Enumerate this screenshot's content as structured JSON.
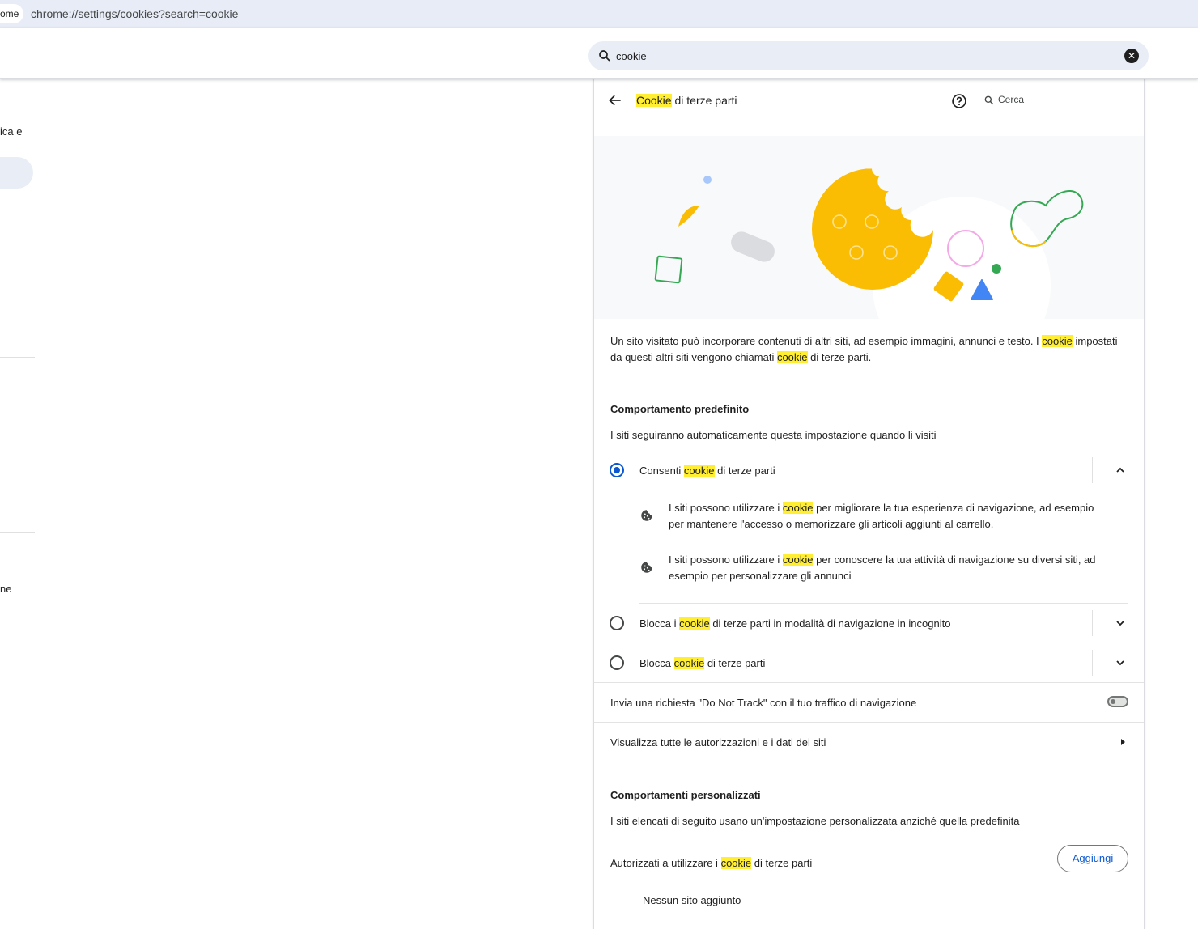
{
  "browser": {
    "tab_fragment": "ome",
    "url": "chrome://settings/cookies?search=cookie"
  },
  "settings_search": {
    "value": "cookie",
    "clear_glyph": "✕"
  },
  "left_nav": {
    "fragment_1": "ica e",
    "fragment_2": "ne"
  },
  "panel": {
    "title_highlight": "Cookie",
    "title_rest": " di terze parti",
    "search_placeholder": "Cerca",
    "description": {
      "part1": "Un sito visitato può incorporare contenuti di altri siti, ad esempio immagini, annunci e testo. I ",
      "hl1": "cookie",
      "part2": " impostati da questi altri siti vengono chiamati ",
      "hl2": "cookie",
      "part3": " di terze parti."
    },
    "default_behavior": {
      "title": "Comportamento predefinito",
      "subtitle": "I siti seguiranno automaticamente questa impostazione quando li visiti",
      "options": [
        {
          "pre": "Consenti ",
          "hl": "cookie",
          "post": " di terze parti",
          "selected": true,
          "expanded": true
        },
        {
          "pre": "Blocca i ",
          "hl": "cookie",
          "post": " di terze parti in modalità di navigazione in incognito",
          "selected": false,
          "expanded": false
        },
        {
          "pre": "Blocca ",
          "hl": "cookie",
          "post": " di terze parti",
          "selected": false,
          "expanded": false
        }
      ],
      "details": [
        {
          "pre": "I siti possono utilizzare i ",
          "hl": "cookie",
          "post": " per migliorare la tua esperienza di navigazione, ad esempio per mantenere l'accesso o memorizzare gli articoli aggiunti al carrello."
        },
        {
          "pre": "I siti possono utilizzare i ",
          "hl": "cookie",
          "post": " per conoscere la tua attività di navigazione su diversi siti, ad esempio per personalizzare gli annunci"
        }
      ]
    },
    "do_not_track": {
      "label": "Invia una richiesta \"Do Not Track\" con il tuo traffico di navigazione",
      "enabled": false
    },
    "site_data_link": "Visualizza tutte le autorizzazioni e i dati dei siti",
    "custom_behavior": {
      "title": "Comportamenti personalizzati",
      "subtitle": "I siti elencati di seguito usano un'impostazione personalizzata anziché quella predefinita",
      "allowed": {
        "pre": "Autorizzati a utilizzare i ",
        "hl": "cookie",
        "post": " di terze parti"
      },
      "add_button": "Aggiungi",
      "empty_text": "Nessun sito aggiunto"
    }
  },
  "colors": {
    "accent": "#0b57d0",
    "highlight": "#ffee32",
    "cookie_yellow": "#fbbc04",
    "green": "#34a853",
    "blue": "#4285f4",
    "pink": "#f4a8e7"
  },
  "icons": [
    "search-icon",
    "clear-icon",
    "back-arrow-icon",
    "help-icon",
    "cookie-icon",
    "chevron-up-icon",
    "chevron-down-icon",
    "arrow-right-icon"
  ]
}
